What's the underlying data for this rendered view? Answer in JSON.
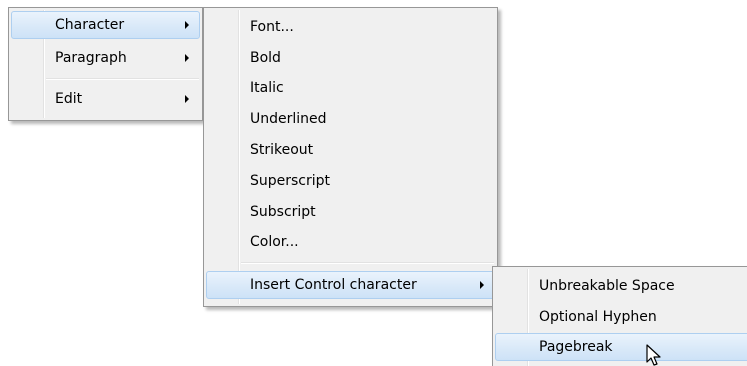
{
  "menu_main": {
    "items": [
      {
        "label": "Character"
      },
      {
        "label": "Paragraph"
      },
      {
        "label": "Edit"
      }
    ]
  },
  "menu_character": {
    "items": [
      {
        "label": "Font..."
      },
      {
        "label": "Bold"
      },
      {
        "label": "Italic"
      },
      {
        "label": "Underlined"
      },
      {
        "label": "Strikeout"
      },
      {
        "label": "Superscript"
      },
      {
        "label": "Subscript"
      },
      {
        "label": "Color..."
      },
      {
        "label": "Insert Control character"
      }
    ]
  },
  "menu_control": {
    "items": [
      {
        "label": "Unbreakable Space"
      },
      {
        "label": "Optional Hyphen"
      },
      {
        "label": "Pagebreak"
      }
    ]
  },
  "colors": {
    "menu_bg": "#f0f0f0",
    "highlight_border": "#aecff0",
    "highlight_fill": "#dbeaf9"
  },
  "icons": {
    "submenu": "chevron-right-icon",
    "cursor": "mouse-pointer-icon"
  }
}
